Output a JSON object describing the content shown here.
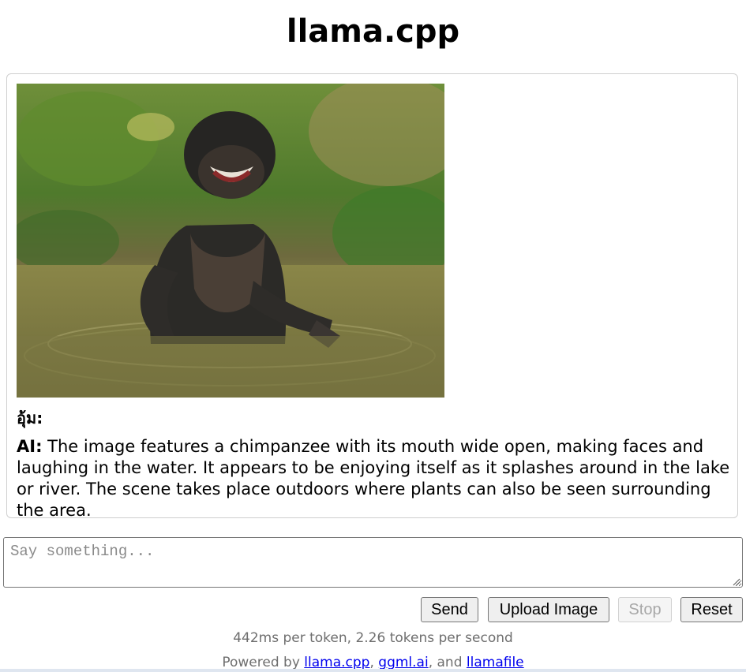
{
  "app": {
    "title": "llama.cpp"
  },
  "chat": {
    "image": {
      "description_icon": "chimpanzee-photo",
      "colors": {
        "water": "#8f8f52",
        "foliage": "#5f8a36",
        "fur": "#2a2a28"
      }
    },
    "user_label": "อุ้ม:",
    "ai_label": "AI:",
    "ai_message": "The image features a chimpanzee with its mouth wide open, making faces and laughing in the water. It appears to be enjoying itself as it splashes around in the lake or river. The scene takes place outdoors where plants can also be seen surrounding the area."
  },
  "input": {
    "placeholder": "Say something...",
    "value": ""
  },
  "buttons": {
    "send": "Send",
    "upload": "Upload Image",
    "stop": "Stop",
    "reset": "Reset",
    "stop_disabled": true
  },
  "stats": {
    "text": "442ms per token, 2.26 tokens per second"
  },
  "footer": {
    "prefix": "Powered by ",
    "link1": "llama.cpp",
    "sep1": ", ",
    "link2": "ggml.ai",
    "sep2": ", and ",
    "link3": "llamafile"
  }
}
